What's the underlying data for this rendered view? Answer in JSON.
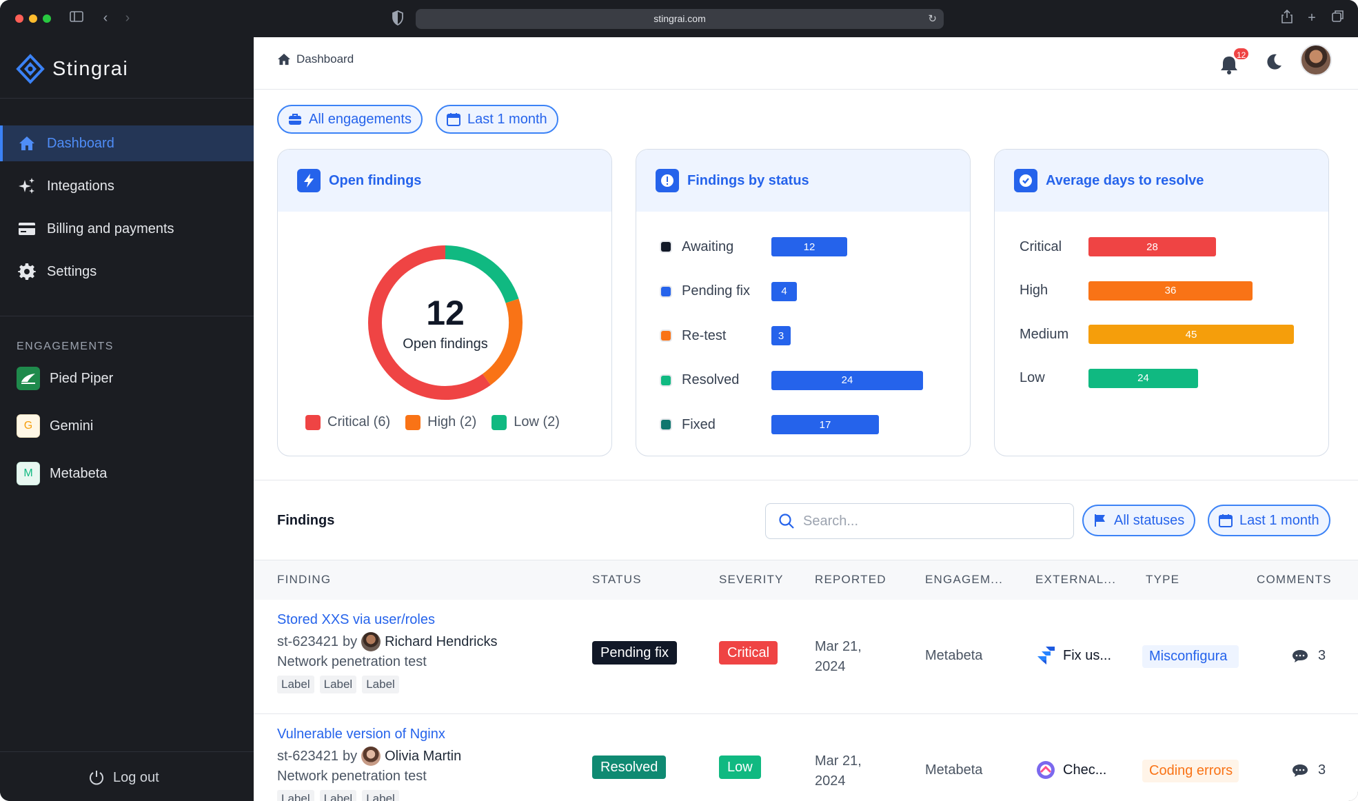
{
  "browser": {
    "url": "stingrai.com"
  },
  "sidebar": {
    "brand": "Stingrai",
    "nav": [
      {
        "label": "Dashboard",
        "icon": "home-icon"
      },
      {
        "label": "Integations",
        "icon": "sparkles-icon"
      },
      {
        "label": "Billing and payments",
        "icon": "credit-card-icon"
      },
      {
        "label": "Settings",
        "icon": "gear-icon"
      }
    ],
    "engagements_heading": "ENGAGEMENTS",
    "engagements": [
      {
        "label": "Pied Piper",
        "badge": "pp",
        "color": "#1f8a4c"
      },
      {
        "label": "Gemini",
        "badge": "G",
        "color": "#f59e0b"
      },
      {
        "label": "Metabeta",
        "badge": "M",
        "color": "#10b981"
      }
    ],
    "logout": "Log out"
  },
  "topbar": {
    "breadcrumb": "Dashboard",
    "notifications": "12"
  },
  "filters": {
    "engagements": "All engagements",
    "period": "Last 1 month"
  },
  "cards": {
    "open_findings": {
      "title": "Open findings",
      "total": "12",
      "total_label": "Open findings",
      "legend": [
        {
          "label": "Critical (6)",
          "color": "#ef4444"
        },
        {
          "label": "High (2)",
          "color": "#f97316"
        },
        {
          "label": "Low (2)",
          "color": "#10b981"
        }
      ]
    },
    "by_status": {
      "title": "Findings by status",
      "rows": [
        {
          "label": "Awaiting",
          "value": 12,
          "color": "#111827"
        },
        {
          "label": "Pending fix",
          "value": 4,
          "color": "#2563eb"
        },
        {
          "label": "Re-test",
          "value": 3,
          "color": "#f97316"
        },
        {
          "label": "Resolved",
          "value": 24,
          "color": "#10b981"
        },
        {
          "label": "Fixed",
          "value": 17,
          "color": "#0f766e"
        }
      ]
    },
    "avg_days": {
      "title": "Average days to resolve",
      "rows": [
        {
          "label": "Critical",
          "value": 28,
          "color": "#ef4444"
        },
        {
          "label": "High",
          "value": 36,
          "color": "#f97316"
        },
        {
          "label": "Medium",
          "value": 45,
          "color": "#f59e0b"
        },
        {
          "label": "Low",
          "value": 24,
          "color": "#10b981"
        }
      ]
    }
  },
  "chart_data": [
    {
      "type": "pie",
      "title": "Open findings",
      "categories": [
        "Critical",
        "High",
        "Low"
      ],
      "values": [
        6,
        2,
        2
      ]
    },
    {
      "type": "bar",
      "title": "Findings by status",
      "categories": [
        "Awaiting",
        "Pending fix",
        "Re-test",
        "Resolved",
        "Fixed"
      ],
      "values": [
        12,
        4,
        3,
        24,
        17
      ]
    },
    {
      "type": "bar",
      "title": "Average days to resolve",
      "categories": [
        "Critical",
        "High",
        "Medium",
        "Low"
      ],
      "values": [
        28,
        36,
        45,
        24
      ]
    }
  ],
  "findings": {
    "title": "Findings",
    "search_placeholder": "Search...",
    "status_filter": "All statuses",
    "period_filter": "Last 1 month",
    "columns": [
      "FINDING",
      "STATUS",
      "SEVERITY",
      "REPORTED",
      "ENGAGEM...",
      "EXTERNAL...",
      "TYPE",
      "COMMENTS"
    ],
    "rows": [
      {
        "title": "Stored XXS via user/roles",
        "id": "st-623421",
        "by": "by",
        "person": "Richard Hendricks",
        "test": "Network penetration test",
        "labels": [
          "Label",
          "Label",
          "Label"
        ],
        "status": "Pending fix",
        "status_color": "#111827",
        "severity": "Critical",
        "severity_color": "#ef4444",
        "date_line1": "Mar 21,",
        "date_line2": "2024",
        "engagement": "Metabeta",
        "external": "Fix us...",
        "external_icon": "jira-icon",
        "type": "Misconfigura",
        "type_color": "#2563eb",
        "type_bg": "#eef4ff",
        "comments": "3"
      },
      {
        "title": "Vulnerable version of Nginx",
        "id": "st-623421",
        "by": "by",
        "person": "Olivia Martin",
        "test": "Network penetration test",
        "labels": [
          "Label",
          "Label",
          "Label"
        ],
        "status": "Resolved",
        "status_color": "#0f8a72",
        "severity": "Low",
        "severity_color": "#10b981",
        "date_line1": "Mar 21,",
        "date_line2": "2024",
        "engagement": "Metabeta",
        "external": "Chec...",
        "external_icon": "clickup-icon",
        "type": "Coding errors",
        "type_color": "#f97316",
        "type_bg": "#fff4e8",
        "comments": "3"
      }
    ]
  }
}
